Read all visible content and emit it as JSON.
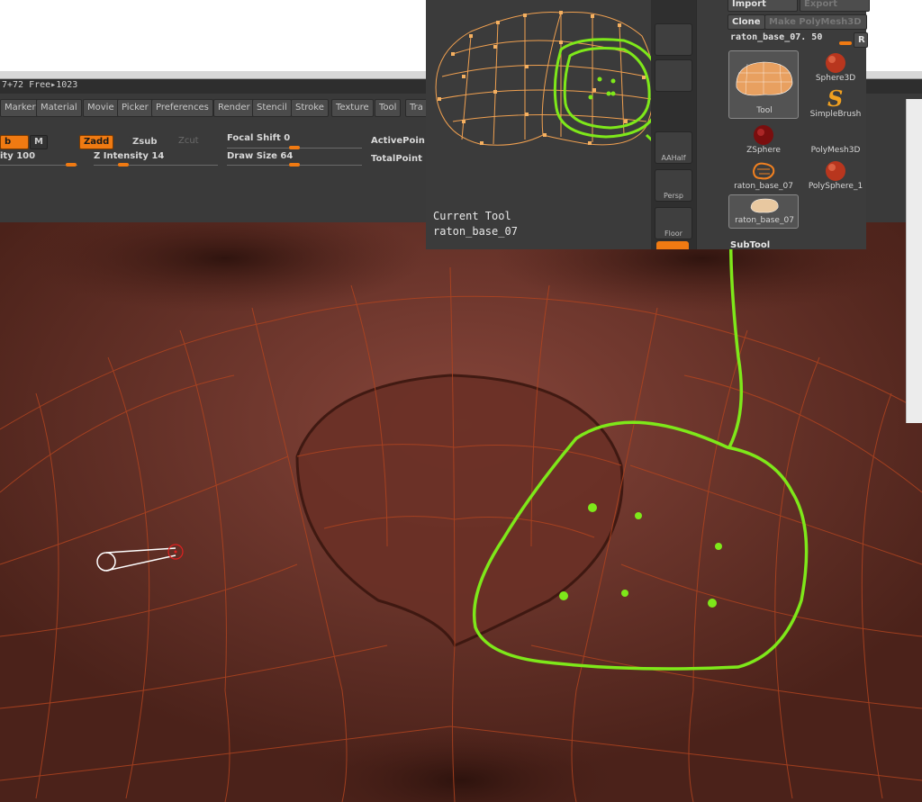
{
  "status": {
    "text": "7+72 Free▸1023"
  },
  "menu": [
    {
      "label": "Marker"
    },
    {
      "label": "Material"
    },
    {
      "label": "Movie"
    },
    {
      "label": "Picker"
    },
    {
      "label": "Preferences"
    },
    {
      "label": "Render"
    },
    {
      "label": "Stencil"
    },
    {
      "label": "Stroke"
    },
    {
      "label": "Texture"
    },
    {
      "label": "Tool"
    },
    {
      "label": "Tra"
    }
  ],
  "brush": {
    "rgb_partial": "b",
    "m_label": "M",
    "zadd": "Zadd",
    "zsub": "Zsub",
    "zcut": "Zcut",
    "intensity_partial": "ity 100",
    "z_intensity": "Z Intensity 14",
    "focal_shift": "Focal Shift 0",
    "draw_size": "Draw Size 64",
    "active_points": "ActivePoin",
    "total_points": "TotalPoint",
    "intensity_level": 1.0,
    "z_intensity_level": 0.14,
    "focal_shift_level": 0.5,
    "draw_size_level": 0.5
  },
  "current_tool": {
    "label": "Current Tool",
    "name": "raton_base_07"
  },
  "side_buttons": [
    {
      "label": ""
    },
    {
      "label": ""
    },
    {
      "label": "AAHalf"
    },
    {
      "label": "Persp"
    },
    {
      "label": "Floor"
    }
  ],
  "palette": {
    "import": "Import",
    "export": "Export",
    "clone": "Clone",
    "make_polymesh": "Make PolyMesh3D",
    "tool_slider": "raton_base_07. 50",
    "r_btn": "R",
    "thumbs": [
      {
        "label": "Tool"
      },
      {
        "label": "Sphere3D"
      },
      {
        "label": "SimpleBrush"
      },
      {
        "label": "ZSphere"
      },
      {
        "label": "PolyMesh3D"
      },
      {
        "label": "raton_base_07"
      },
      {
        "label": "PolySphere_1"
      },
      {
        "label": "raton_base_07"
      }
    ],
    "subtool": "SubTool"
  },
  "colors": {
    "accent": "#f07a12",
    "annotation": "#7ee81a",
    "wire": "#b04420"
  },
  "icons": {
    "cursor": "brush-cursor-icon",
    "sphere": "sphere3d-icon",
    "simplebrush": "simplebrush-s-icon",
    "zsphere": "zsphere-icon",
    "polysphere": "polysphere-icon"
  }
}
